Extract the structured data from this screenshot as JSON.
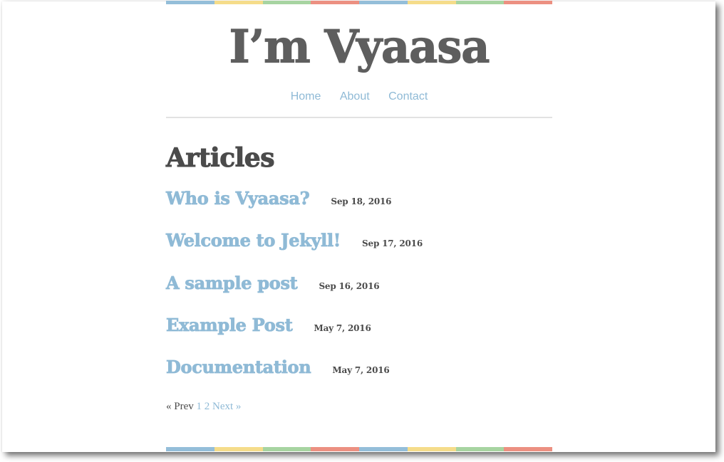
{
  "colors": {
    "blue": "#94bed9",
    "yellow": "#f5dc8a",
    "green": "#a7d4a1",
    "red": "#ec9081",
    "link": "#8fbad6",
    "text": "#4b4b4b"
  },
  "header": {
    "site_title": "I’m Vyaasa",
    "nav": [
      {
        "label": "Home"
      },
      {
        "label": "About"
      },
      {
        "label": "Contact"
      }
    ]
  },
  "main": {
    "heading": "Articles",
    "posts": [
      {
        "title": "Who is Vyaasa?",
        "date": "Sep 18, 2016"
      },
      {
        "title": "Welcome to Jekyll!",
        "date": "Sep 17, 2016"
      },
      {
        "title": "A sample post",
        "date": "Sep 16, 2016"
      },
      {
        "title": "Example Post",
        "date": "May 7, 2016"
      },
      {
        "title": "Documentation",
        "date": "May 7, 2016"
      }
    ],
    "pagination": {
      "prev_label": "« Prev",
      "pages": [
        "1",
        "2"
      ],
      "next_label": "Next »"
    }
  }
}
